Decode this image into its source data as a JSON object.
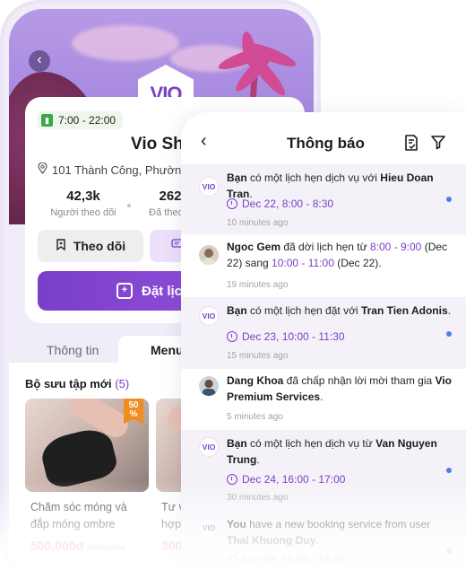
{
  "shop": {
    "back_icon": "chevron-left-icon",
    "logo_text": "VIO",
    "hours": "7:00 - 22:00",
    "name": "Vio Sho",
    "address": "101 Thành Công, Phường",
    "stats": [
      {
        "value": "42,3k",
        "label": "Người theo dõi"
      },
      {
        "value": "262",
        "label": "Đã theo d"
      }
    ],
    "follow_label": "Theo dõi",
    "book_label": "Đặt lịch",
    "tabs": {
      "info": "Thông tin",
      "menu": "Menu"
    },
    "collection_title": "Bộ sưu tập mới",
    "collection_count": "(5)",
    "products": [
      {
        "name_line1": "Chăm sóc móng và",
        "name_line2": "đắp móng ombre",
        "price": "500,000đ",
        "old_price": "1000,000đ",
        "badge": "50",
        "badge_unit": "%"
      },
      {
        "name_line1": "Tư v",
        "name_line2": "hợp",
        "price": "300",
        "old_price": "",
        "badge": "",
        "badge_unit": ""
      }
    ],
    "colors": {
      "accent": "#7b3fc6",
      "price": "#e24a4a",
      "badge": "#f28c1e"
    }
  },
  "notifications": {
    "title": "Thông báo",
    "back_icon": "chevron-left-icon",
    "actions": [
      "mark-read-icon",
      "filter-icon"
    ],
    "items": [
      {
        "type": "booking",
        "icon": "VIO",
        "unread": true,
        "prefix": "Bạn",
        "text": " có một lịch hẹn dịch vụ với ",
        "user": "Hieu Doan Tran",
        "suffix": ".",
        "schedule": "Dec 22, 8:00 - 8:30",
        "time": "10 minutes ago"
      },
      {
        "type": "reschedule",
        "icon": "avatar",
        "unread": false,
        "user": "Ngoc Gem",
        "text1": " đã dời lịch hẹn từ ",
        "from_time": "8:00 - 9:00",
        "text2": " (Dec 22) sang ",
        "to_time": "10:00 - 11:00",
        "text3": " (Dec 22).",
        "time": "19 minutes ago"
      },
      {
        "type": "booking",
        "icon": "VIO",
        "unread": true,
        "prefix": "Bạn",
        "text": " có một lịch hẹn đặt với ",
        "user": "Tran Tien Adonis",
        "suffix": ".",
        "schedule": "Dec 23, 10:00 - 11:30",
        "time": "15 minutes ago"
      },
      {
        "type": "accepted",
        "icon": "avatar",
        "unread": false,
        "user": "Dang Khoa",
        "text": " đã chấp nhận lời mời tham gia ",
        "org": "Vio Premium Services",
        "suffix": ".",
        "time": "5 minutes ago"
      },
      {
        "type": "booking",
        "icon": "VIO",
        "unread": true,
        "prefix": "Bạn",
        "text": " có một lịch hẹn dịch vụ từ ",
        "user": "Van Nguyen Trung",
        "suffix": ".",
        "schedule": "Dec 24, 16:00 - 17:00",
        "time": "30 minutes ago"
      },
      {
        "type": "booking",
        "icon": "VIO",
        "unread": true,
        "prefix": "You",
        "text": " have a new booking service from user ",
        "user": "Thai Khuong Duy",
        "suffix": ".",
        "schedule": "Dec 26, 15:00 - 16:00",
        "time": ""
      }
    ]
  }
}
